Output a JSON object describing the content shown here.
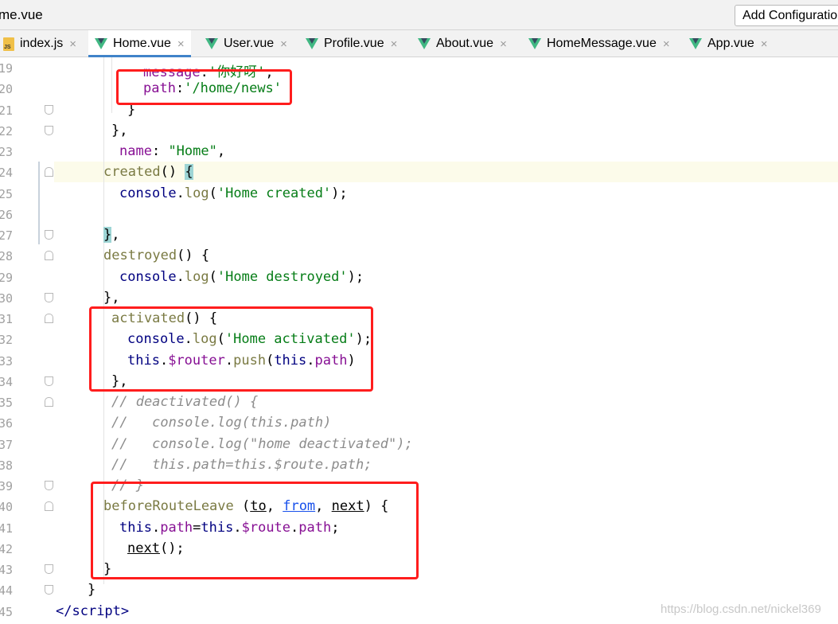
{
  "window": {
    "file_title": "me.vue",
    "run_config_label": "Add Configuration..."
  },
  "tabs": [
    {
      "label": "index.js",
      "icon": "js-file-icon",
      "active": false
    },
    {
      "label": "Home.vue",
      "icon": "vue-file-icon",
      "active": true
    },
    {
      "label": "User.vue",
      "icon": "vue-file-icon",
      "active": false
    },
    {
      "label": "Profile.vue",
      "icon": "vue-file-icon",
      "active": false
    },
    {
      "label": "About.vue",
      "icon": "vue-file-icon",
      "active": false
    },
    {
      "label": "HomeMessage.vue",
      "icon": "vue-file-icon",
      "active": false
    },
    {
      "label": "App.vue",
      "icon": "vue-file-icon",
      "active": false
    }
  ],
  "tab_close_glyph": "×",
  "line_numbers": [
    "19",
    "20",
    "21",
    "22",
    "23",
    "24",
    "25",
    "26",
    "27",
    "28",
    "29",
    "30",
    "31",
    "32",
    "33",
    "34",
    "35",
    "36",
    "37",
    "38",
    "39",
    "40",
    "41",
    "42",
    "43",
    "44",
    "45"
  ],
  "code": {
    "l19": {
      "prop": "message",
      "colon": ":",
      "str": "'你好呀'",
      "end": ","
    },
    "l20": {
      "prop": "path",
      "colon": ":",
      "str": "'/home/news'"
    },
    "l21": {
      "text": "}"
    },
    "l22": {
      "text": "},"
    },
    "l23": {
      "prop": "name",
      "colon": ": ",
      "str": "\"Home\"",
      "end": ","
    },
    "l24": {
      "fn": "created",
      "rest": "() ",
      "brace": "{"
    },
    "l25": {
      "obj": "console",
      "dot": ".",
      "fn": "log",
      "open": "(",
      "str": "'Home created'",
      "close": ");"
    },
    "l27": {
      "brace": "}",
      "end": ","
    },
    "l28": {
      "fn": "destroyed",
      "rest": "() {"
    },
    "l29": {
      "obj": "console",
      "dot": ".",
      "fn": "log",
      "open": "(",
      "str": "'Home destroyed'",
      "close": ");"
    },
    "l30": {
      "text": "},"
    },
    "l31": {
      "fn": "activated",
      "rest": "() {"
    },
    "l32": {
      "obj": "console",
      "dot": ".",
      "fn": "log",
      "open": "(",
      "str": "'Home activated'",
      "close": ");"
    },
    "l33": {
      "kw": "this",
      "dot1": ".",
      "prop1": "$router",
      "dot2": ".",
      "fn": "push",
      "open": "(",
      "kw2": "this",
      "dot3": ".",
      "prop2": "path",
      "close": ")"
    },
    "l34": {
      "text": "},"
    },
    "l35": {
      "cmt": "// deactivated() {"
    },
    "l36": {
      "cmt": "//   console.log(this.path)"
    },
    "l37": {
      "cmt": "//   console.log(\"home deactivated\");"
    },
    "l38": {
      "cmt": "//   this.path=this.$route.path;"
    },
    "l39": {
      "cmt": "// }"
    },
    "l40": {
      "fn": "beforeRouteLeave",
      "open": " (",
      "p1": "to",
      "sep1": ", ",
      "p2": "from",
      "sep2": ", ",
      "p3": "next",
      "close": ") {"
    },
    "l41": {
      "kw": "this",
      "dot1": ".",
      "prop1": "path",
      "eq": "=",
      "kw2": "this",
      "dot2": ".",
      "prop2": "$route",
      "dot3": ".",
      "prop3": "path",
      "end": ";"
    },
    "l42": {
      "fn": "next",
      "rest": "();"
    },
    "l43": {
      "text": "}"
    },
    "l44": {
      "text": "}"
    },
    "l45": {
      "open": "</",
      "tag": "script",
      "close": ">"
    }
  },
  "watermark": "https://blog.csdn.net/nickel369"
}
